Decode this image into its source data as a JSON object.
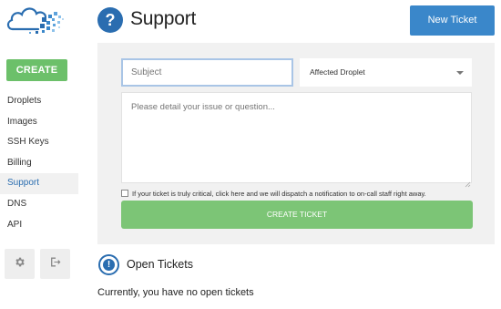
{
  "sidebar": {
    "create_label": "CREATE",
    "items": [
      {
        "label": "Droplets",
        "active": false
      },
      {
        "label": "Images",
        "active": false
      },
      {
        "label": "SSH Keys",
        "active": false
      },
      {
        "label": "Billing",
        "active": false
      },
      {
        "label": "Support",
        "active": true
      },
      {
        "label": "DNS",
        "active": false
      },
      {
        "label": "API",
        "active": false
      }
    ],
    "bottom_icons": [
      "gear-icon",
      "logout-icon"
    ]
  },
  "header": {
    "icon": "question-icon",
    "title": "Support",
    "new_ticket_label": "New Ticket"
  },
  "form": {
    "subject_placeholder": "Subject",
    "subject_value": "",
    "droplet_select_value": "Affected Droplet",
    "details_placeholder": "Please detail your issue or question...",
    "critical_checked": false,
    "critical_text": "If your ticket is truly critical, click here and we will dispatch a notification to on-call staff right away.",
    "submit_label": "CREATE TICKET"
  },
  "open_tickets": {
    "icon": "exclamation-icon",
    "title": "Open Tickets",
    "empty_message": "Currently, you have no open tickets"
  },
  "colors": {
    "accent_blue": "#2a6db0",
    "new_ticket_blue": "#3a87ca",
    "create_green": "#6cc06a",
    "submit_green": "#7cc576",
    "panel_gray": "#f1f1f1"
  }
}
